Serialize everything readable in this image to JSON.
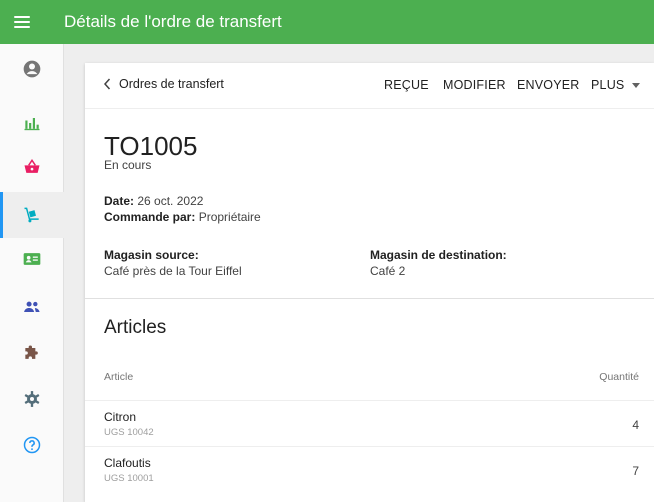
{
  "header": {
    "title": "Détails de l'ordre de transfert",
    "color": "#4caf50"
  },
  "sidebar": {
    "active_accent": "#2196f3",
    "items": [
      {
        "name": "account-icon",
        "color": "#757575"
      },
      {
        "name": "bar-chart-icon",
        "color": "#4caf50"
      },
      {
        "name": "basket-icon",
        "color": "#e91e63"
      },
      {
        "name": "dolly-icon",
        "color": "#00acc1",
        "active": true
      },
      {
        "name": "id-card-icon",
        "color": "#4caf50"
      },
      {
        "name": "people-icon",
        "color": "#3f51b5"
      },
      {
        "name": "puzzle-icon",
        "color": "#795548"
      },
      {
        "name": "gear-icon",
        "color": "#546e7a"
      },
      {
        "name": "help-icon",
        "color": "#2196f3"
      }
    ]
  },
  "toolbar": {
    "back_label": "Ordres de transfert",
    "recue_label": "REÇUE",
    "modifier_label": "MODIFIER",
    "envoyer_label": "ENVOYER",
    "plus_label": "PLUS"
  },
  "order": {
    "id": "TO1005",
    "status": "En cours",
    "date_label": "Date:",
    "date_value": "26 oct. 2022",
    "ordered_by_label": "Commande par:",
    "ordered_by_value": "Propriétaire",
    "source_label": "Magasin source:",
    "source_value": "Café près de la Tour Eiffel",
    "destination_label": "Magasin de destination:",
    "destination_value": "Café 2"
  },
  "articles": {
    "title": "Articles",
    "col_article": "Article",
    "col_quantity": "Quantité",
    "rows": [
      {
        "name": "Citron",
        "sku": "UGS 10042",
        "quantity": "4"
      },
      {
        "name": "Clafoutis",
        "sku": "UGS 10001",
        "quantity": "7"
      }
    ]
  }
}
